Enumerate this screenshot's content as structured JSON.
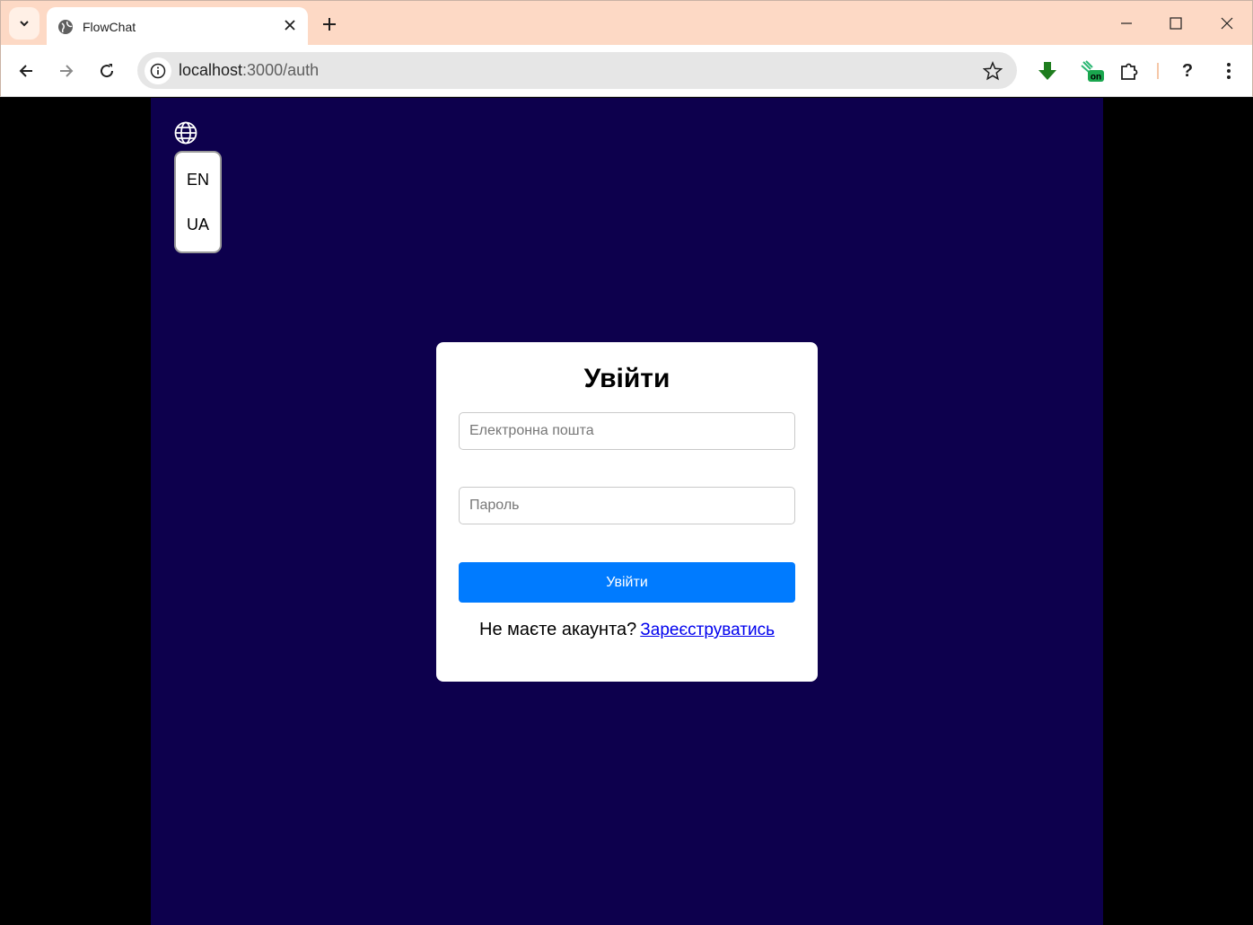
{
  "browser": {
    "tab": {
      "title": "FlowChat"
    },
    "omnibox": {
      "host": "localhost",
      "path": ":3000/auth"
    },
    "icons": {
      "tab_search": "chevron-down-icon",
      "favicon": "globe-icon",
      "close": "close-icon",
      "new_tab": "plus-icon",
      "back": "back-arrow-icon",
      "forward": "forward-arrow-icon",
      "reload": "reload-icon",
      "bookmark": "star-icon",
      "download": "download-arrow-icon",
      "extension_on": "extension-on-icon",
      "extensions": "puzzle-icon",
      "help": "help-icon",
      "menu": "kebab-menu-icon"
    },
    "extension_badge": "on",
    "help_glyph": "?"
  },
  "language": {
    "icon": "globe-icon",
    "options": [
      "EN",
      "UA"
    ]
  },
  "login": {
    "title": "Увійти",
    "email_placeholder": "Електронна пошта",
    "password_placeholder": "Пароль",
    "submit_label": "Увійти",
    "no_account_text": "Не маєте акаунта?",
    "register_link": "Зареєструватись"
  },
  "colors": {
    "app_background": "#0d004d",
    "outer_background": "#000000",
    "primary_button": "#007bff",
    "titlebar": "#fdd9c5",
    "link": "#0000ee"
  }
}
